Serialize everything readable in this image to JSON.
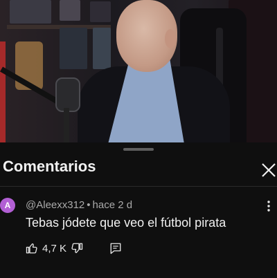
{
  "video": {
    "description_colors": {
      "accent_red": "#a52a2a"
    }
  },
  "comments_panel": {
    "title": "Comentarios",
    "close_icon": "close-icon"
  },
  "comment": {
    "avatar_letter": "A",
    "avatar_color": "#b25fd4",
    "author": "@Aleexx312",
    "separator": "•",
    "time": "hace 2 d",
    "text": "Tebas jódete que veo el fútbol pirata",
    "likes": "4,7 K",
    "icons": [
      "like-icon",
      "dislike-icon",
      "reply-icon",
      "more-vert-icon"
    ]
  }
}
